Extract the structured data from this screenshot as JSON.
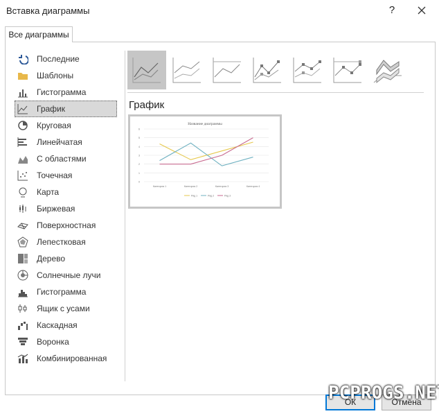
{
  "window": {
    "title": "Вставка диаграммы",
    "help_glyph": "?",
    "close_glyph": "close"
  },
  "tabs": [
    {
      "label": "Все диаграммы"
    }
  ],
  "categories": [
    {
      "label": "Последние",
      "icon": "recent-icon"
    },
    {
      "label": "Шаблоны",
      "icon": "folder-icon"
    },
    {
      "label": "Гистограмма",
      "icon": "column-chart-icon"
    },
    {
      "label": "График",
      "icon": "line-chart-icon",
      "selected": true
    },
    {
      "label": "Круговая",
      "icon": "pie-chart-icon"
    },
    {
      "label": "Линейчатая",
      "icon": "bar-chart-icon"
    },
    {
      "label": "С областями",
      "icon": "area-chart-icon"
    },
    {
      "label": "Точечная",
      "icon": "scatter-chart-icon"
    },
    {
      "label": "Карта",
      "icon": "map-chart-icon"
    },
    {
      "label": "Биржевая",
      "icon": "stock-chart-icon"
    },
    {
      "label": "Поверхностная",
      "icon": "surface-chart-icon"
    },
    {
      "label": "Лепестковая",
      "icon": "radar-chart-icon"
    },
    {
      "label": "Дерево",
      "icon": "treemap-chart-icon"
    },
    {
      "label": "Солнечные лучи",
      "icon": "sunburst-chart-icon"
    },
    {
      "label": "Гистограмма",
      "icon": "histogram-chart-icon"
    },
    {
      "label": "Ящик с усами",
      "icon": "box-whisker-chart-icon"
    },
    {
      "label": "Каскадная",
      "icon": "waterfall-chart-icon"
    },
    {
      "label": "Воронка",
      "icon": "funnel-chart-icon"
    },
    {
      "label": "Комбинированная",
      "icon": "combo-chart-icon"
    }
  ],
  "subtypes": [
    {
      "name": "line-subtype-icon",
      "selected": true
    },
    {
      "name": "stacked-line-subtype-icon"
    },
    {
      "name": "100-stacked-line-subtype-icon"
    },
    {
      "name": "line-markers-subtype-icon"
    },
    {
      "name": "stacked-line-markers-subtype-icon"
    },
    {
      "name": "100-stacked-line-markers-subtype-icon"
    },
    {
      "name": "3d-line-subtype-icon"
    }
  ],
  "selected_subtype_title": "График",
  "chart_data": {
    "type": "line",
    "title": "Название диаграммы",
    "categories": [
      "Категория 1",
      "Категория 2",
      "Категория 3",
      "Категория 4"
    ],
    "ylim": [
      0,
      6
    ],
    "yticks": [
      "0",
      "1",
      "2",
      "3",
      "4",
      "5",
      "6"
    ],
    "grid": true,
    "legend": "bottom",
    "series": [
      {
        "name": "Ряд 1",
        "values": [
          4.3,
          2.5,
          3.5,
          4.5
        ],
        "color": "#e6c84c"
      },
      {
        "name": "Ряд 2",
        "values": [
          2.4,
          4.4,
          1.8,
          2.8
        ],
        "color": "#6fb1c1"
      },
      {
        "name": "Ряд 3",
        "values": [
          2.0,
          2.0,
          3.0,
          5.0
        ],
        "color": "#c86a8f"
      }
    ]
  },
  "buttons": {
    "ok": "ОК",
    "cancel": "Отмена"
  },
  "watermark": "PCPROGS.NET",
  "colors": {
    "selection": "#d9d9d9",
    "accent": "#0078d7"
  }
}
